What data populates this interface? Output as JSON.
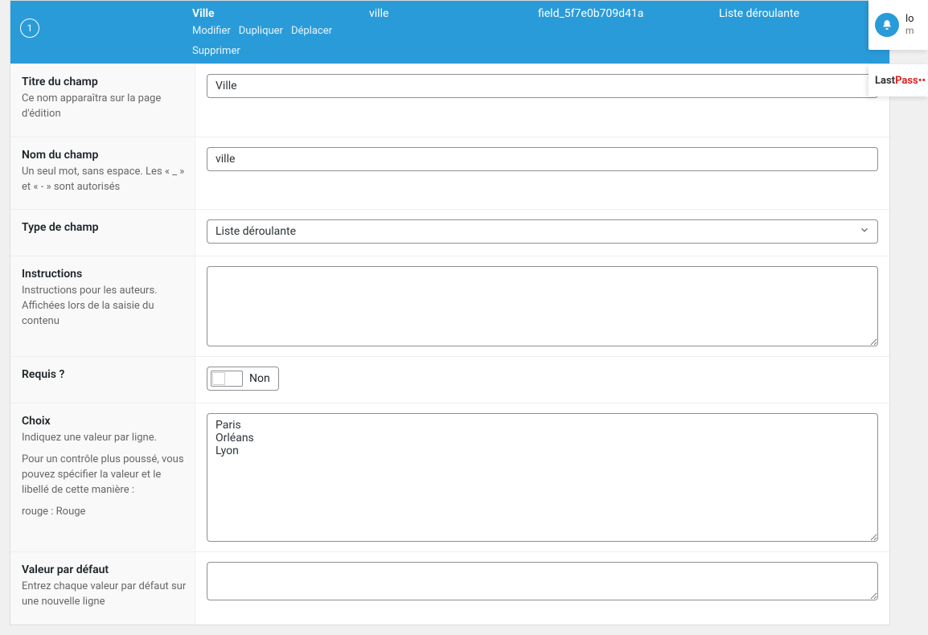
{
  "header": {
    "order": "1",
    "title": "Ville",
    "name": "ville",
    "key": "field_5f7e0b709d41a",
    "type": "Liste déroulante",
    "actions": {
      "edit": "Modifier",
      "duplicate": "Dupliquer",
      "move": "Déplacer",
      "delete": "Supprimer"
    }
  },
  "rows": {
    "title": {
      "label": "Titre du champ",
      "hint": "Ce nom apparaîtra sur la page d'édition",
      "value": "Ville"
    },
    "name": {
      "label": "Nom du champ",
      "hint": "Un seul mot, sans espace. Les « _ » et « - » sont autorisés",
      "value": "ville"
    },
    "type": {
      "label": "Type de champ",
      "value": "Liste déroulante"
    },
    "instructions": {
      "label": "Instructions",
      "hint": "Instructions pour les auteurs. Affichées lors de la saisie du contenu",
      "value": ""
    },
    "required": {
      "label": "Requis ?",
      "value": "Non"
    },
    "choices": {
      "label": "Choix",
      "hint1": "Indiquez une valeur par ligne.",
      "hint2": "Pour un contrôle plus poussé, vous pouvez spécifier la valeur et le libellé de cette manière :",
      "hint3": "rouge : Rouge",
      "value": "Paris\nOrléans\nLyon"
    },
    "default": {
      "label": "Valeur par défaut",
      "hint": "Entrez chaque valeur par défaut sur une nouvelle ligne",
      "value": ""
    }
  },
  "popups": {
    "wp": {
      "line1": "lo",
      "line2": "m"
    },
    "lp": {
      "part1": "Last",
      "part2": "Pass",
      "dots": "••"
    }
  }
}
